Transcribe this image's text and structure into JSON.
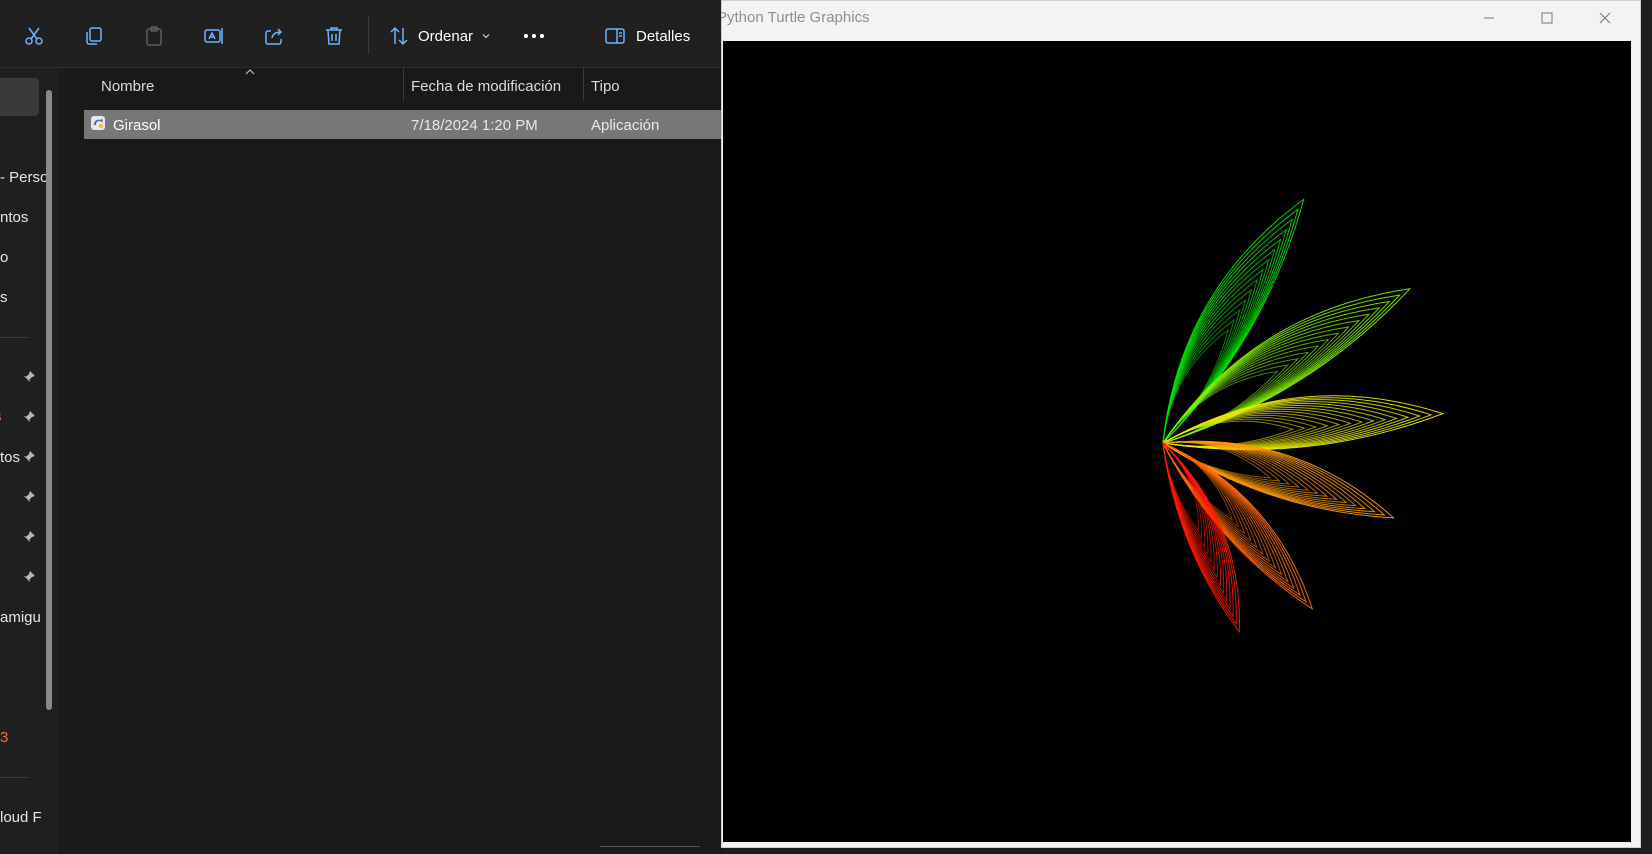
{
  "explorer": {
    "toolbar": {
      "sort_label": "Ordenar",
      "details_label": "Detalles",
      "icons": [
        "cut-icon",
        "copy-icon",
        "paste-icon",
        "rename-icon",
        "share-icon",
        "delete-icon",
        "sort-icon",
        "chevron-down-icon",
        "more-icon",
        "details-pane-icon"
      ]
    },
    "nav": {
      "items": [
        {
          "label": "- Perso"
        },
        {
          "label": "ntos"
        },
        {
          "label": "o"
        },
        {
          "label": "s"
        },
        {
          "label": "s"
        },
        {
          "label": "tos"
        },
        {
          "label": "amigu"
        },
        {
          "label": "3"
        },
        {
          "label": "loud F"
        }
      ]
    },
    "columns": {
      "name": "Nombre",
      "modified": "Fecha de modificación",
      "type": "Tipo"
    },
    "files": [
      {
        "name": "Girasol",
        "modified": "7/18/2024 1:20 PM",
        "type": "Aplicación",
        "icon": "python-app-icon"
      }
    ]
  },
  "turtle": {
    "title": "Python Turtle Graphics",
    "colors": {
      "green": "#00e000",
      "yellow": "#e8e800",
      "orange": "#ff9900",
      "red": "#ff1a00"
    }
  }
}
